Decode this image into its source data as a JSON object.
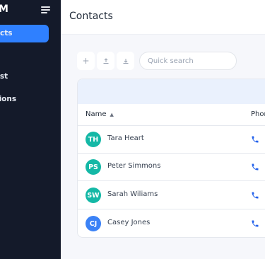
{
  "sidebar": {
    "brand": "M",
    "items": [
      {
        "label": "cts"
      },
      {
        "label": "lcast"
      },
      {
        "label": "nations"
      }
    ]
  },
  "header": {
    "title": "Contacts"
  },
  "toolbar": {
    "add_icon": "+",
    "upload_icon": "upload-icon",
    "download_icon": "download-icon",
    "search_placeholder": "Quick search"
  },
  "table": {
    "columns": [
      "Name",
      "Phor"
    ],
    "rows": [
      {
        "initials": "TH",
        "name": "Tara Heart",
        "avatar_color": "#14b8a6"
      },
      {
        "initials": "PS",
        "name": "Peter Simmons",
        "avatar_color": "#14b8a6"
      },
      {
        "initials": "SW",
        "name": "Sarah Wiliams",
        "avatar_color": "#14b8a6"
      },
      {
        "initials": "CJ",
        "name": "Casey Jones",
        "avatar_color": "#3b82f6"
      }
    ]
  },
  "colors": {
    "sidebar_bg": "#141a2a",
    "accent": "#2f80ff",
    "phone_icon": "#2563eb"
  }
}
